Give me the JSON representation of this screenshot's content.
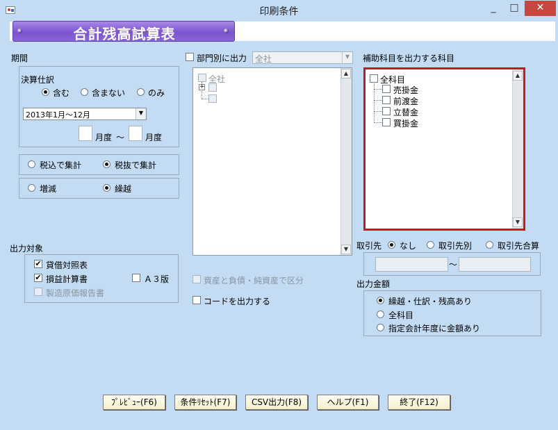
{
  "window": {
    "title": "印刷条件",
    "minimize": "_",
    "maximize": "□",
    "close": "✕"
  },
  "report_title": "合計残高試算表",
  "period": {
    "label": "期間",
    "settlement_label": "決算仕訳",
    "options": [
      "含む",
      "含まない",
      "のみ"
    ],
    "selected": "含む",
    "range_value": "2013年1月～12月",
    "month_from": "",
    "month_to": "",
    "month_suffix": "月度",
    "tilde": "～"
  },
  "tax": {
    "options": [
      "税込で集計",
      "税抜で集計"
    ],
    "selected": "税抜で集計"
  },
  "balance": {
    "options": [
      "増減",
      "繰越"
    ],
    "selected": "繰越"
  },
  "output_target": {
    "label": "出力対象",
    "items": [
      {
        "label": "貸借対照表",
        "checked": true,
        "enabled": true
      },
      {
        "label": "損益計算書",
        "checked": true,
        "enabled": true
      },
      {
        "label": "Ａ３版",
        "checked": false,
        "enabled": true
      },
      {
        "label": "製造原価報告書",
        "checked": false,
        "enabled": false
      }
    ]
  },
  "department": {
    "label": "部門別に出力",
    "checked": false,
    "combo_value": "全社",
    "tree_root": "全社"
  },
  "options": {
    "asset_split": "資産と負債・純資産で区分",
    "asset_split_enabled": false,
    "code_output": "コードを出力する"
  },
  "sub_accounts": {
    "label": "補助科目を出力する科目",
    "root": "全科目",
    "items": [
      "売掛金",
      "前渡金",
      "立替金",
      "買掛金"
    ]
  },
  "client": {
    "label": "取引先",
    "options": [
      "なし",
      "取引先別",
      "取引先合算"
    ],
    "selected": "なし",
    "tilde": "～",
    "from": "",
    "to": ""
  },
  "amount": {
    "label": "出力金額",
    "options": [
      "繰越・仕訳・残高あり",
      "全科目",
      "指定会計年度に金額あり"
    ],
    "selected": "繰越・仕訳・残高あり"
  },
  "buttons": {
    "preview": "ﾌﾟﾚﾋﾞｭｰ(F6)",
    "reset": "条件ﾘｾｯﾄ(F7)",
    "csv": "CSV出力(F8)",
    "help": "ヘルプ(F1)",
    "exit": "終了(F12)"
  }
}
